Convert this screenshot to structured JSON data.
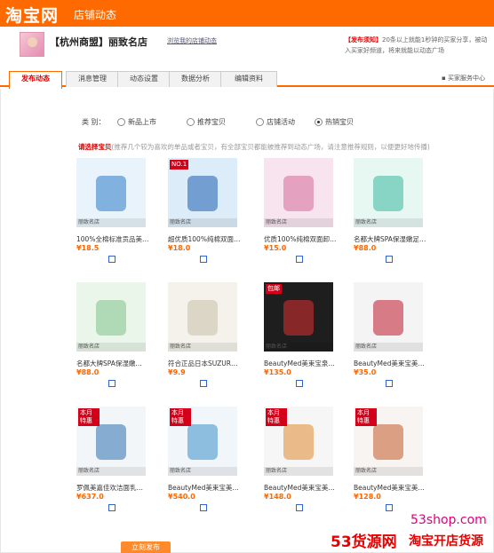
{
  "topbar": {
    "logo": "淘宝网",
    "title": "店铺动态"
  },
  "store": {
    "name": "【杭州商盟】丽致名店",
    "sub_link": "浏览我的店铺动态",
    "notice_hl": "【发布须知】",
    "notice": "20条以上就能1秒钟的买家分享，被动入买家好频道，将来就能以动态广场"
  },
  "tabs": [
    {
      "label": "发布动态"
    },
    {
      "label": "消息管理"
    },
    {
      "label": "动态设置"
    },
    {
      "label": "数据分析"
    },
    {
      "label": "编辑资料"
    }
  ],
  "tab_right": "买家服务中心",
  "category": {
    "label": "类 别：",
    "options": [
      "新品上市",
      "推荐宝贝",
      "店铺活动",
      "热销宝贝"
    ],
    "selected_index": 3
  },
  "section": {
    "title": "请选择宝贝",
    "desc": "(推荐几个较为喜欢的单品或者宝贝，有全部宝贝都能被推荐到动态广场，请注意推荐规则，以便更好地传播)"
  },
  "products": [
    {
      "name": "100%全棉标准贡品美…",
      "price": "18.5",
      "color": "#e8f3fb",
      "accent": "#2a7ac9",
      "badge": ""
    },
    {
      "name": "超优质100%纯棉双面…",
      "price": "18.0",
      "color": "#dcecf8",
      "accent": "#1e5fb0",
      "badge": "NO.1"
    },
    {
      "name": "优质100%纯棉双面卸…",
      "price": "15.0",
      "color": "#f8e4ee",
      "accent": "#d46a9a",
      "badge": ""
    },
    {
      "name": "名都大牌SPA保湿嫩足…",
      "price": "88.0",
      "color": "#e7f7f2",
      "accent": "#3bb8a0",
      "badge": ""
    },
    {
      "name": "名都大牌SPA保湿嫩…",
      "price": "88.0",
      "color": "#eaf6e9",
      "accent": "#7ec28a",
      "badge": ""
    },
    {
      "name": "符合正品日本SUZUR…",
      "price": "9.9",
      "color": "#f4f2ea",
      "accent": "#c8c0a8",
      "badge": ""
    },
    {
      "name": "BeautyMed美束宝泉…",
      "price": "135.0",
      "color": "#1e1e1e",
      "accent": "#e03030",
      "badge": "包邮"
    },
    {
      "name": "BeautyMed美束宝美…",
      "price": "35.0",
      "color": "#f4f4f4",
      "accent": "#c0182c",
      "badge": ""
    },
    {
      "name": "罗佩美嘉佳欢洁面乳…",
      "price": "637.0",
      "color": "#f3f6f8",
      "accent": "#2c6fb0",
      "badge": "本月特惠"
    },
    {
      "name": "BeautyMed美束宝美…",
      "price": "540.0",
      "color": "#f1f6fa",
      "accent": "#3a8fc9",
      "badge": "本月特惠"
    },
    {
      "name": "BeautyMed美束宝美…",
      "price": "148.0",
      "color": "#f6f6f6",
      "accent": "#e08a30",
      "badge": "本月特惠"
    },
    {
      "name": "BeautyMed美束宝美…",
      "price": "128.0",
      "color": "#f7f4f2",
      "accent": "#c45a2a",
      "badge": "本月特惠"
    }
  ],
  "shop_tag": "丽致名店",
  "currency": "¥",
  "submit_label": "立刻发布",
  "watermark": {
    "site": "53shop.com",
    "brand": "53货源网",
    "slogan": "淘宝开店货源"
  }
}
